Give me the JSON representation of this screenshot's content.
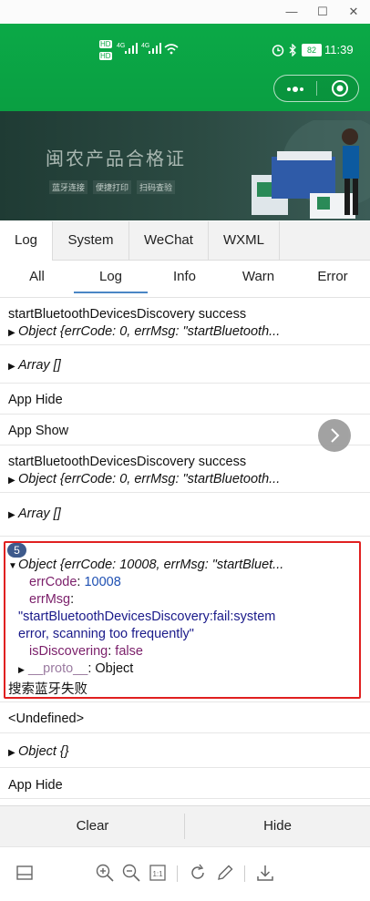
{
  "window": {
    "minimize_glyph": "—",
    "maximize_glyph": "☐",
    "close_glyph": "✕"
  },
  "statusbar": {
    "sim1": "HD",
    "sim2": "HD",
    "net1": "4G",
    "net2": "4G",
    "battery": "82",
    "time": "11:39"
  },
  "banner": {
    "title": "闽农产品合格证",
    "tags": [
      "蓝牙连接",
      "便捷打印",
      "扫码查验"
    ]
  },
  "tabs_top": [
    "Log",
    "System",
    "WeChat",
    "WXML"
  ],
  "tabs_sub": [
    "All",
    "Log",
    "Info",
    "Warn",
    "Error"
  ],
  "log": {
    "e1_line1": "startBluetoothDevicesDiscovery success",
    "e1_line2": "Object {errCode: 0, errMsg: \"startBluetooth...",
    "e2": "Array []",
    "e3": "App Hide",
    "e4": "App Show",
    "e5_line1": "startBluetoothDevicesDiscovery success",
    "e5_line2": "Object {errCode: 0, errMsg: \"startBluetooth...",
    "e6": "Array []",
    "e7": {
      "badge": "5",
      "header": "Object {errCode: 10008, errMsg: \"startBluet...",
      "errCode_key": "errCode",
      "errCode_val": "10008",
      "errMsg_key": "errMsg",
      "errMsg_val_1": "\"startBluetoothDevicesDiscovery:fail:system",
      "errMsg_val_2": "error, scanning too frequently\"",
      "isDiscovering_key": "isDiscovering",
      "isDiscovering_val": "false",
      "proto_key": "__proto__",
      "proto_val": "Object",
      "message": "搜索蓝牙失败"
    },
    "e8": "<Undefined>",
    "e9": "Object {}",
    "e10": "App Hide"
  },
  "buttons": {
    "clear": "Clear",
    "hide": "Hide"
  },
  "colors": {
    "header_green": "#0aa945",
    "highlight_red": "#e02020",
    "active_tab_underline": "#4a86c5"
  }
}
